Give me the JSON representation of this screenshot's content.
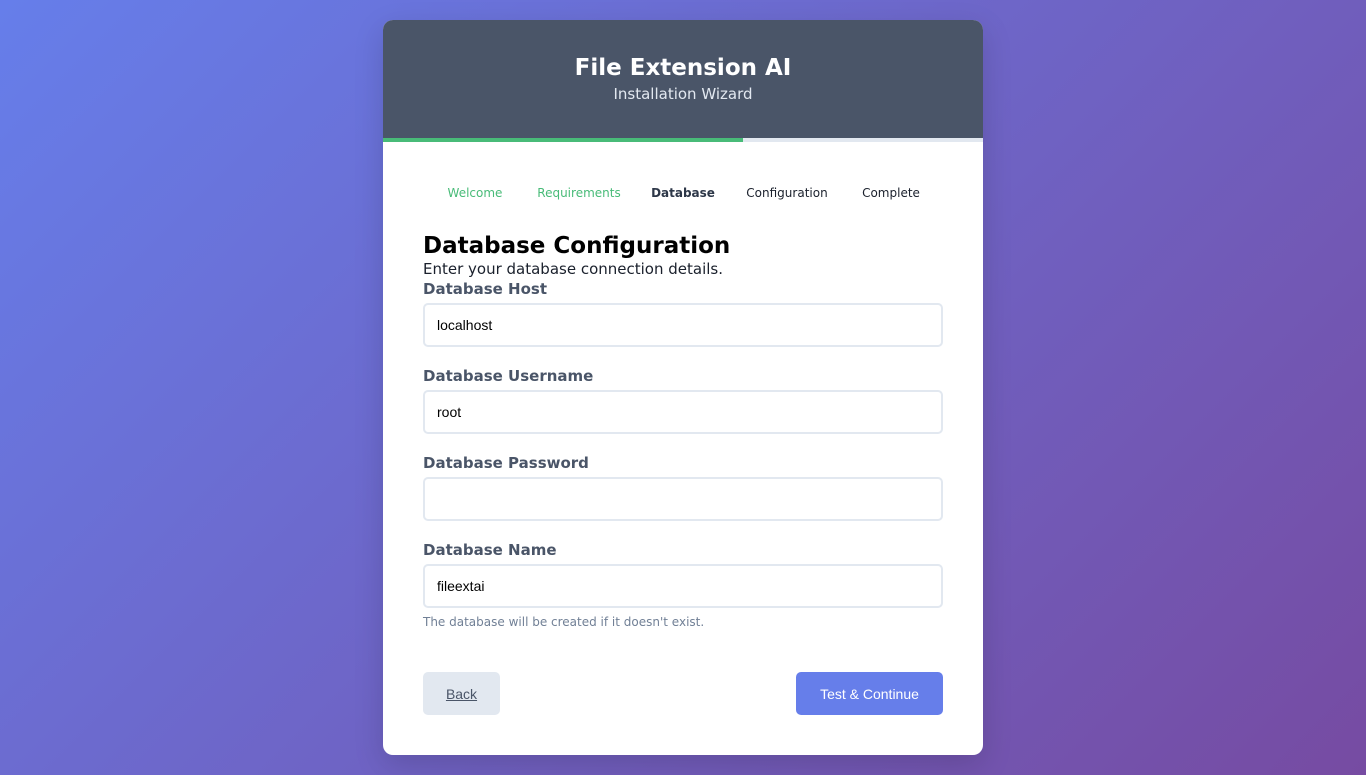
{
  "header": {
    "title": "File Extension AI",
    "subtitle": "Installation Wizard"
  },
  "progress": {
    "fraction": 0.6,
    "color": "#48bb78"
  },
  "steps": [
    {
      "label": "Welcome",
      "state": "done"
    },
    {
      "label": "Requirements",
      "state": "done"
    },
    {
      "label": "Database",
      "state": "active"
    },
    {
      "label": "Configuration",
      "state": "pending"
    },
    {
      "label": "Complete",
      "state": "pending"
    }
  ],
  "page": {
    "heading": "Database Configuration",
    "intro": "Enter your database connection details."
  },
  "fields": {
    "host": {
      "label": "Database Host",
      "value": "localhost"
    },
    "username": {
      "label": "Database Username",
      "value": "root"
    },
    "password": {
      "label": "Database Password",
      "value": ""
    },
    "name": {
      "label": "Database Name",
      "value": "fileextai",
      "hint": "The database will be created if it doesn't exist."
    }
  },
  "actions": {
    "back_label": "Back",
    "next_label": "Test & Continue"
  },
  "colors": {
    "header_bg": "#4a5568",
    "accent": "#667eea",
    "success": "#48bb78"
  }
}
